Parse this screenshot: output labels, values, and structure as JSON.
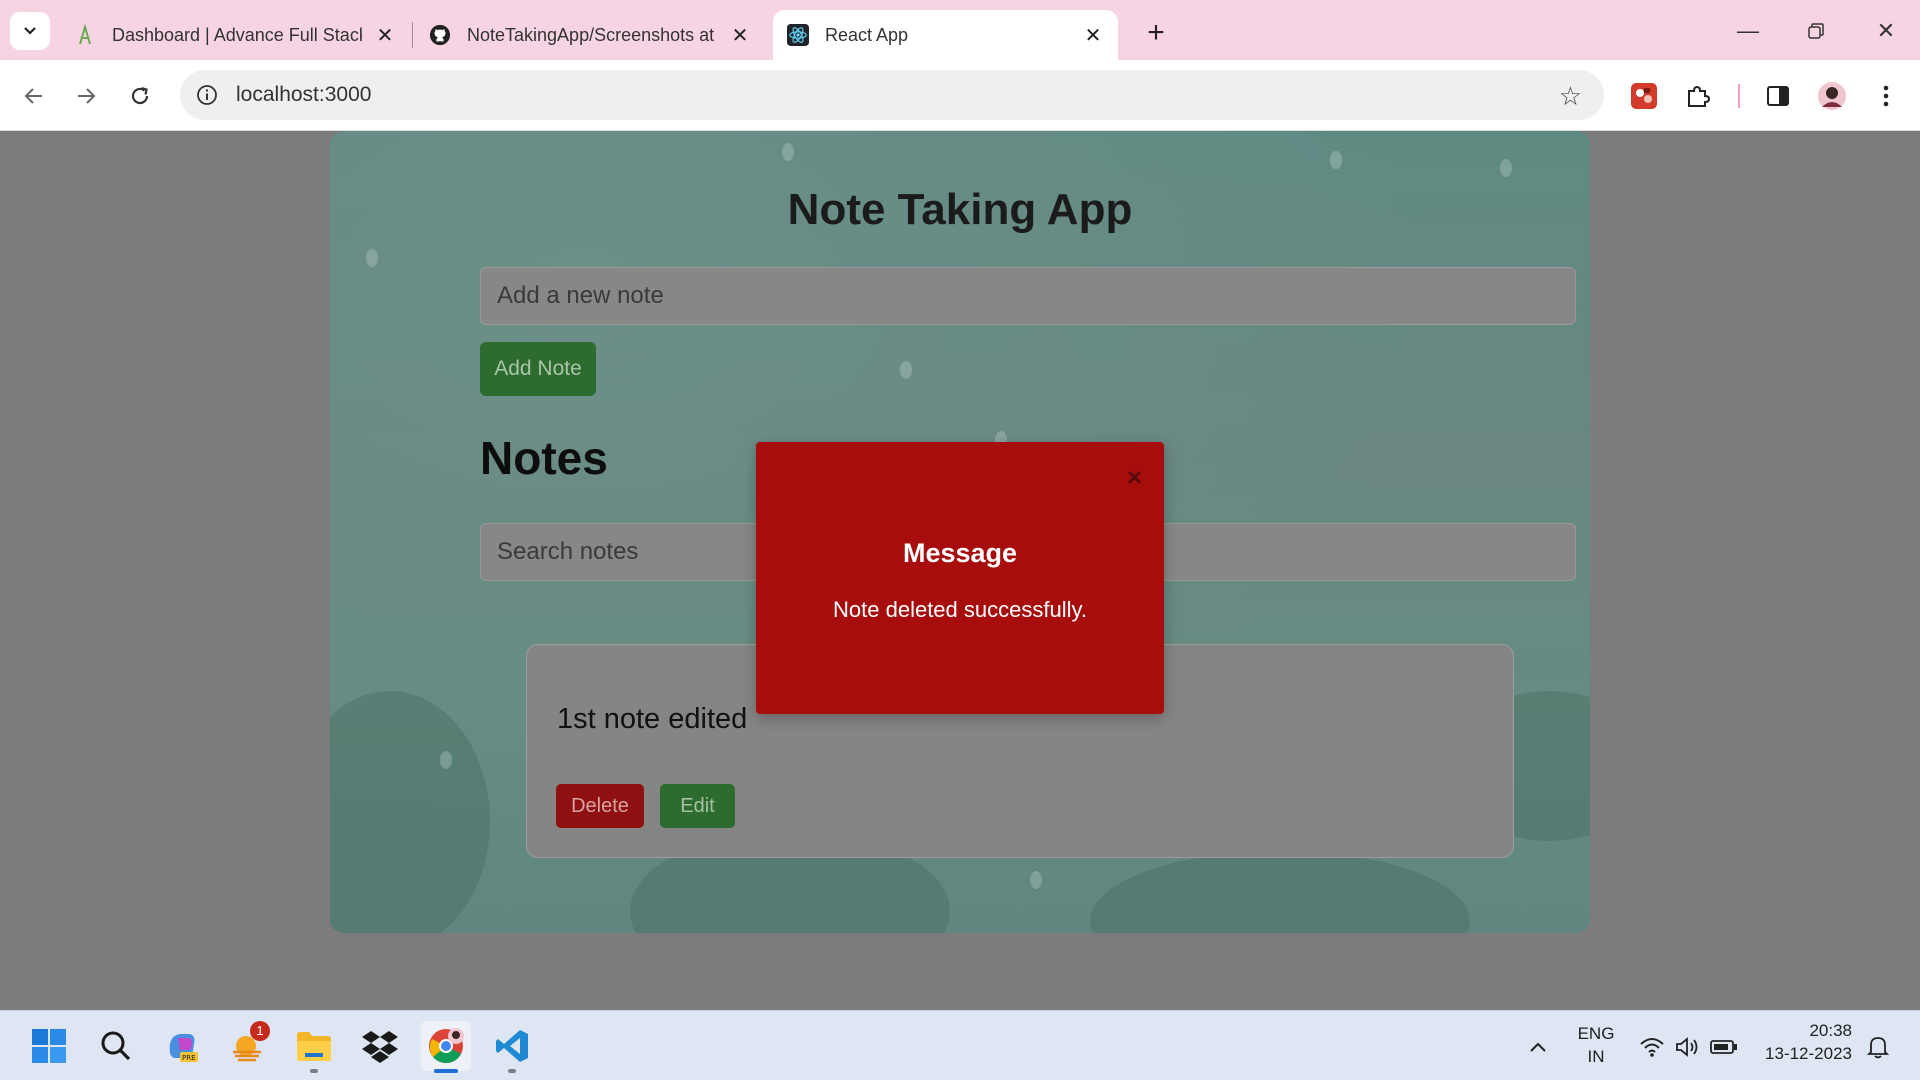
{
  "browser": {
    "tabs": [
      {
        "title": "Dashboard | Advance Full Stack",
        "icon": "course-logo-icon",
        "active": false
      },
      {
        "title": "NoteTakingApp/Screenshots at",
        "icon": "github-icon",
        "active": false
      },
      {
        "title": "React App",
        "icon": "react-icon",
        "active": true
      }
    ],
    "url": "localhost:3000"
  },
  "app": {
    "title": "Note Taking App",
    "new_note_placeholder": "Add a new note",
    "add_button": "Add Note",
    "notes_heading": "Notes",
    "search_placeholder": "Search notes",
    "notes": [
      {
        "text": "1st note edited",
        "delete_label": "Delete",
        "edit_label": "Edit"
      }
    ]
  },
  "modal": {
    "close": "×",
    "title": "Message",
    "message": "Note deleted successfully."
  },
  "taskbar": {
    "notification_badge": "1",
    "language": "ENG",
    "region": "IN",
    "time": "20:38",
    "date": "13-12-2023"
  },
  "colors": {
    "tab_strip": "#f6d4e3",
    "modal_background": "#a80d0d",
    "add_button": "#2d6b2f",
    "delete_button": "#8e1010"
  }
}
